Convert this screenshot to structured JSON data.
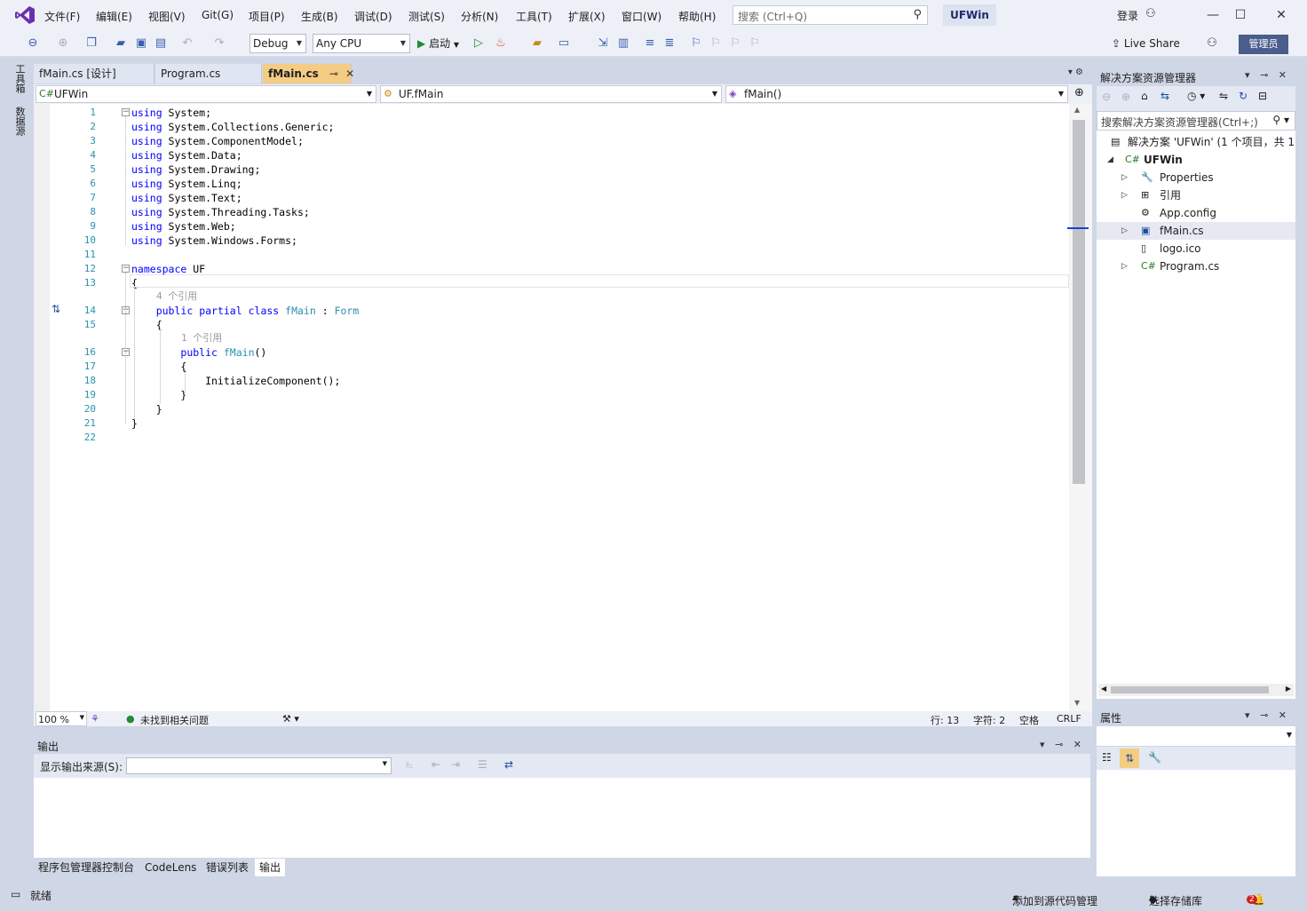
{
  "menu": {
    "items": [
      "文件(F)",
      "编辑(E)",
      "视图(V)",
      "Git(G)",
      "项目(P)",
      "生成(B)",
      "调试(D)",
      "测试(S)",
      "分析(N)",
      "工具(T)",
      "扩展(X)",
      "窗口(W)",
      "帮助(H)"
    ],
    "search_placeholder": "搜索 (Ctrl+Q)",
    "solution_name": "UFWin",
    "login": "登录"
  },
  "toolbar": {
    "config": "Debug",
    "platform": "Any CPU",
    "start_label": "启动",
    "live_share": "Live Share",
    "admin_badge": "管理员"
  },
  "left_rail": {
    "toolbox": "工具箱",
    "datasource": "数据源"
  },
  "editor_tabs": [
    {
      "label": "fMain.cs [设计]",
      "active": false
    },
    {
      "label": "Program.cs",
      "active": false
    },
    {
      "label": "fMain.cs",
      "active": true
    }
  ],
  "navbar": {
    "project": "UFWin",
    "class": "UF.fMain",
    "member": "fMain()"
  },
  "code": {
    "lines": [
      {
        "n": "1",
        "segments": [
          [
            "kw",
            "using"
          ],
          [
            "",
            " System;"
          ]
        ]
      },
      {
        "n": "2",
        "segments": [
          [
            "kw",
            "using"
          ],
          [
            "",
            " System.Collections.Generic;"
          ]
        ]
      },
      {
        "n": "3",
        "segments": [
          [
            "kw",
            "using"
          ],
          [
            "",
            " System.ComponentModel;"
          ]
        ]
      },
      {
        "n": "4",
        "segments": [
          [
            "kw",
            "using"
          ],
          [
            "",
            " System.Data;"
          ]
        ]
      },
      {
        "n": "5",
        "segments": [
          [
            "kw",
            "using"
          ],
          [
            "",
            " System.Drawing;"
          ]
        ]
      },
      {
        "n": "6",
        "segments": [
          [
            "kw",
            "using"
          ],
          [
            "",
            " System.Linq;"
          ]
        ]
      },
      {
        "n": "7",
        "segments": [
          [
            "kw",
            "using"
          ],
          [
            "",
            " System.Text;"
          ]
        ]
      },
      {
        "n": "8",
        "segments": [
          [
            "kw",
            "using"
          ],
          [
            "",
            " System.Threading.Tasks;"
          ]
        ]
      },
      {
        "n": "9",
        "segments": [
          [
            "kw",
            "using"
          ],
          [
            "",
            " System.Web;"
          ]
        ]
      },
      {
        "n": "10",
        "segments": [
          [
            "kw",
            "using"
          ],
          [
            "",
            " System.Windows.Forms;"
          ]
        ]
      },
      {
        "n": "11",
        "segments": []
      },
      {
        "n": "12",
        "segments": [
          [
            "kw",
            "namespace"
          ],
          [
            "",
            " UF"
          ]
        ]
      },
      {
        "n": "13",
        "segments": [
          [
            "",
            "{"
          ]
        ]
      },
      {
        "n": "14",
        "segments": [
          [
            "",
            "    "
          ],
          [
            "kw",
            "public"
          ],
          [
            "",
            " "
          ],
          [
            "kw",
            "partial"
          ],
          [
            "",
            " "
          ],
          [
            "kw",
            "class"
          ],
          [
            "",
            " "
          ],
          [
            "ty",
            "fMain"
          ],
          [
            "",
            " : "
          ],
          [
            "ty",
            "Form"
          ]
        ]
      },
      {
        "n": "15",
        "segments": [
          [
            "",
            "    {"
          ]
        ]
      },
      {
        "n": "16",
        "segments": [
          [
            "",
            "        "
          ],
          [
            "kw",
            "public"
          ],
          [
            "",
            " "
          ],
          [
            "ty",
            "fMain"
          ],
          [
            "",
            "()"
          ]
        ]
      },
      {
        "n": "17",
        "segments": [
          [
            "",
            "        {"
          ]
        ]
      },
      {
        "n": "18",
        "segments": [
          [
            "",
            "            InitializeComponent();"
          ]
        ]
      },
      {
        "n": "19",
        "segments": [
          [
            "",
            "        }"
          ]
        ]
      },
      {
        "n": "20",
        "segments": [
          [
            "",
            "    }"
          ]
        ]
      },
      {
        "n": "21",
        "segments": [
          [
            "",
            "}"
          ]
        ]
      },
      {
        "n": "22",
        "segments": []
      }
    ],
    "lens_class": "4 个引用",
    "lens_ctor": "1 个引用"
  },
  "edit_status": {
    "zoom": "100 %",
    "issues": "未找到相关问题",
    "line": "行: 13",
    "char": "字符: 2",
    "space": "空格",
    "eol": "CRLF"
  },
  "output": {
    "title": "输出",
    "source_label": "显示输出来源(S):",
    "source_value": ""
  },
  "bottom_tabs": [
    {
      "label": "程序包管理器控制台",
      "active": false
    },
    {
      "label": "CodeLens",
      "active": false
    },
    {
      "label": "错误列表",
      "active": false
    },
    {
      "label": "输出",
      "active": true
    }
  ],
  "solution_explorer": {
    "title": "解决方案资源管理器",
    "search_placeholder": "搜索解决方案资源管理器(Ctrl+;)",
    "tree": [
      {
        "label": "解决方案 'UFWin' (1 个项目，共 1",
        "level": 0,
        "icon": "solution-icon",
        "arrow": ""
      },
      {
        "label": "UFWin",
        "level": 1,
        "icon": "csharp-project-icon",
        "arrow": "open",
        "bold": true
      },
      {
        "label": "Properties",
        "level": 2,
        "icon": "wrench-icon",
        "arrow": "closed"
      },
      {
        "label": "引用",
        "level": 2,
        "icon": "references-icon",
        "arrow": "closed"
      },
      {
        "label": "App.config",
        "level": 2,
        "icon": "config-icon",
        "arrow": ""
      },
      {
        "label": "fMain.cs",
        "level": 2,
        "icon": "form-icon",
        "arrow": "closed",
        "selected": true
      },
      {
        "label": "logo.ico",
        "level": 2,
        "icon": "ico-file-icon",
        "arrow": ""
      },
      {
        "label": "Program.cs",
        "level": 2,
        "icon": "csharp-file-icon",
        "arrow": "closed"
      }
    ]
  },
  "properties": {
    "title": "属性"
  },
  "statusbar": {
    "ready": "就绪",
    "add_source": "添加到源代码管理",
    "repo": "选择存储库",
    "notifications": "2"
  }
}
